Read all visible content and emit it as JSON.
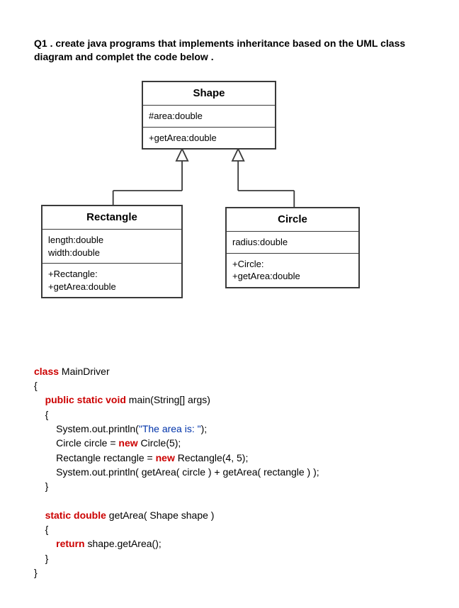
{
  "question": {
    "prefix": "Q1 .",
    "text": " create java programs that implements inheritance based on the UML class diagram and complet the code below  ."
  },
  "uml": {
    "shape": {
      "title": "Shape",
      "attr1": "#area:double",
      "op1": "+getArea:double"
    },
    "rectangle": {
      "title": "Rectangle",
      "attr1": "length:double",
      "attr2": "width:double",
      "op1": "+Rectangle:",
      "op2": "+getArea:double"
    },
    "circle": {
      "title": "Circle",
      "attr1": "radius:double",
      "op1": "+Circle:",
      "op2": "+getArea:double"
    }
  },
  "code": {
    "l01_kw": "class",
    "l01_rest": " MainDriver",
    "l02": "{",
    "l03_kw": "public static void",
    "l03_rest": " main(String[] args)",
    "l04": "{",
    "l05a": "System.out.println(",
    "l05b": "\"The area is: \"",
    "l05c": ");",
    "l06a": "Circle circle = ",
    "l06b": "new",
    "l06c": " Circle(5);",
    "l07a": "Rectangle rectangle = ",
    "l07b": "new",
    "l07c": " Rectangle(4, 5);",
    "l08": "System.out.println( getArea( circle ) + getArea( rectangle ) );",
    "l09": "}",
    "l10_kw": "static double",
    "l10_rest": " getArea( Shape shape )",
    "l11": "{",
    "l12_kw": "return",
    "l12_rest": " shape.getArea();",
    "l13": "}",
    "l14": "}"
  }
}
